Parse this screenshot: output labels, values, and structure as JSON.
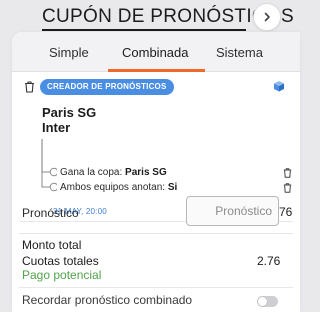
{
  "header": {
    "title": "CUPÓN DE PRONÓSTICOS",
    "chevron_icon": "chevron-right-icon"
  },
  "tabs": [
    {
      "label": "Simple",
      "active": false
    },
    {
      "label": "Combinada",
      "active": true
    },
    {
      "label": "Sistema",
      "active": false
    }
  ],
  "colors": {
    "accent": "#f06a28",
    "badge": "#4a8ee3",
    "date": "#3f7fd4",
    "potential": "#52a24a"
  },
  "bet": {
    "badge": "CREADOR DE PRONÓSTICOS",
    "teams": [
      "Paris SG",
      "Inter"
    ],
    "selections": [
      {
        "market": "Gana la copa: ",
        "pick": "Paris SG"
      },
      {
        "market": "Ambos equipos anotan: ",
        "pick": "Si"
      }
    ],
    "date": "31 MAY, 20:00",
    "odds": "2.76"
  },
  "stake": {
    "label": "Pronóstico",
    "placeholder": "Pronóstico"
  },
  "summary": {
    "monto_label": "Monto total",
    "cuotas_label": "Cuotas totales",
    "cuotas_value": "2.76",
    "pago_label": "Pago potencial"
  },
  "remember": {
    "label": "Recordar pronóstico combinado",
    "enabled": false
  }
}
